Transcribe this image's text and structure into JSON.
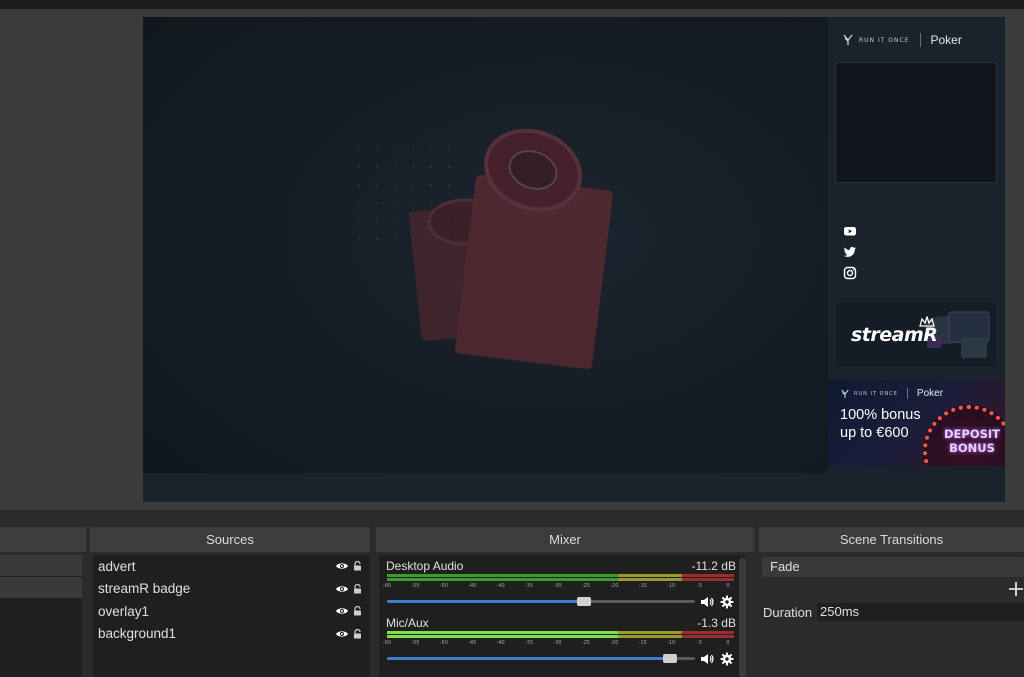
{
  "program": {
    "sidebar": {
      "brand_small": "RUN IT ONCE",
      "brand_poker": "Poker",
      "social_icons": [
        "youtube-icon",
        "twitter-icon",
        "instagram-icon"
      ],
      "badge_text": "streamR"
    },
    "advert": {
      "brand_small": "RUN IT ONCE",
      "brand_poker": "Poker",
      "line1": "100% bonus",
      "line2": "up to €600",
      "deposit_line1": "DEPOSIT",
      "deposit_line2": "BONUS"
    }
  },
  "panels": {
    "sources_title": "Sources",
    "mixer_title": "Mixer",
    "transitions_title": "Scene Transitions"
  },
  "sources": [
    {
      "name": "advert",
      "visible": true,
      "locked": false
    },
    {
      "name": "streamR badge",
      "visible": true,
      "locked": false
    },
    {
      "name": "overlay1",
      "visible": true,
      "locked": false
    },
    {
      "name": "background1",
      "visible": true,
      "locked": false
    }
  ],
  "mixer": {
    "tick_labels": [
      "-60",
      "-55",
      "-50",
      "-45",
      "-40",
      "-35",
      "-30",
      "-25",
      "-20",
      "-15",
      "-10",
      "-5",
      "0"
    ],
    "channels": [
      {
        "name": "Desktop Audio",
        "db": "-11.2 dB",
        "level_db": -60,
        "volume": 0.64
      },
      {
        "name": "Mic/Aux",
        "db": "-1.3 dB",
        "level_db": -20,
        "volume": 0.92
      }
    ]
  },
  "transitions": {
    "selected": "Fade",
    "duration_label": "Duration",
    "duration_value": "250ms"
  },
  "colors": {
    "meter_green": "#3f9a2e",
    "meter_green_active": "#7be04b",
    "meter_yellow": "#9a9a2e",
    "meter_yellow_active": "#e6e62e",
    "meter_red": "#9a2e2e",
    "fader_blue": "#3e7fd0"
  }
}
